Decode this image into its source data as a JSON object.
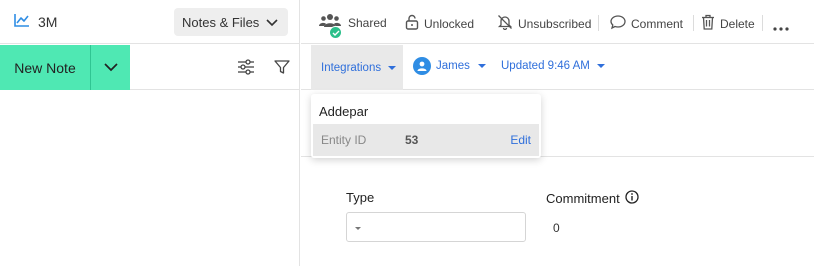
{
  "header": {
    "company_name": "3M",
    "view_selector_label": "Notes & Files"
  },
  "left_toolbar": {
    "new_note_label": "New Note"
  },
  "toolbar": {
    "shared_label": "Shared",
    "unlocked_label": "Unlocked",
    "unsubscribed_label": "Unsubscribed",
    "comment_label": "Comment",
    "delete_label": "Delete"
  },
  "meta": {
    "integrations_label": "Integrations",
    "user_name": "James",
    "updated_label": "Updated 9:46 AM"
  },
  "integration_popup": {
    "title": "Addepar",
    "field_label": "Entity ID",
    "field_value": "53",
    "edit_label": "Edit"
  },
  "form": {
    "type_label": "Type",
    "type_value": "",
    "commitment_label": "Commitment",
    "commitment_value": "0"
  },
  "colors": {
    "accent_green": "#4fe8b3",
    "link_blue": "#2f6fdb",
    "brand_blue": "#2f8de4",
    "badge_green": "#2bbf8a"
  }
}
